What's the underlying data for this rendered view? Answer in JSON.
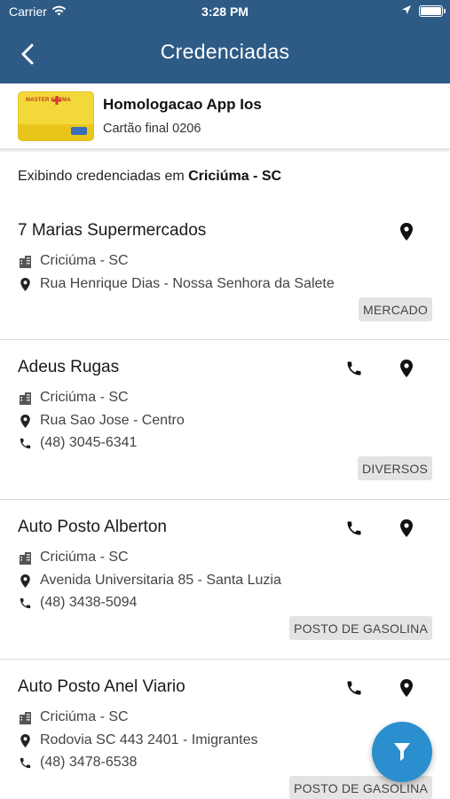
{
  "status_bar": {
    "carrier": "Carrier",
    "time": "3:28 PM",
    "icons": [
      "wifi-icon",
      "location-arrow-icon",
      "battery-icon"
    ]
  },
  "header": {
    "title": "Credenciadas",
    "back_icon": "chevron-left-icon",
    "background_color": "#2d5b86"
  },
  "card": {
    "name": "Homologacao App Ios",
    "number_label": "Cartão final 0206",
    "logo_text": "MASTER FARMA"
  },
  "filter": {
    "prefix": "Exibindo credenciadas em",
    "city": "Criciúma - SC"
  },
  "establishments": [
    {
      "name": "7 Marias Supermercados",
      "city": "Criciúma - SC",
      "address": "Rua Henrique Dias - Nossa Senhora da Salete",
      "phone": "",
      "category": "MERCADO"
    },
    {
      "name": "Adeus Rugas",
      "city": "Criciúma - SC",
      "address": "Rua Sao Jose - Centro",
      "phone": "(48) 3045-6341",
      "category": "DIVERSOS"
    },
    {
      "name": "Auto Posto Alberton",
      "city": "Criciúma - SC",
      "address": "Avenida Universitaria 85 - Santa Luzia",
      "phone": "(48) 3438-5094",
      "category": "POSTO DE GASOLINA"
    },
    {
      "name": "Auto Posto Anel Viario",
      "city": "Criciúma - SC",
      "address": "Rodovia SC 443 2401 - Imigrantes",
      "phone": "(48) 3478-6538",
      "category": "POSTO DE GASOLINA"
    }
  ],
  "fab": {
    "icon": "filter-icon",
    "color": "#2b8fcf"
  }
}
